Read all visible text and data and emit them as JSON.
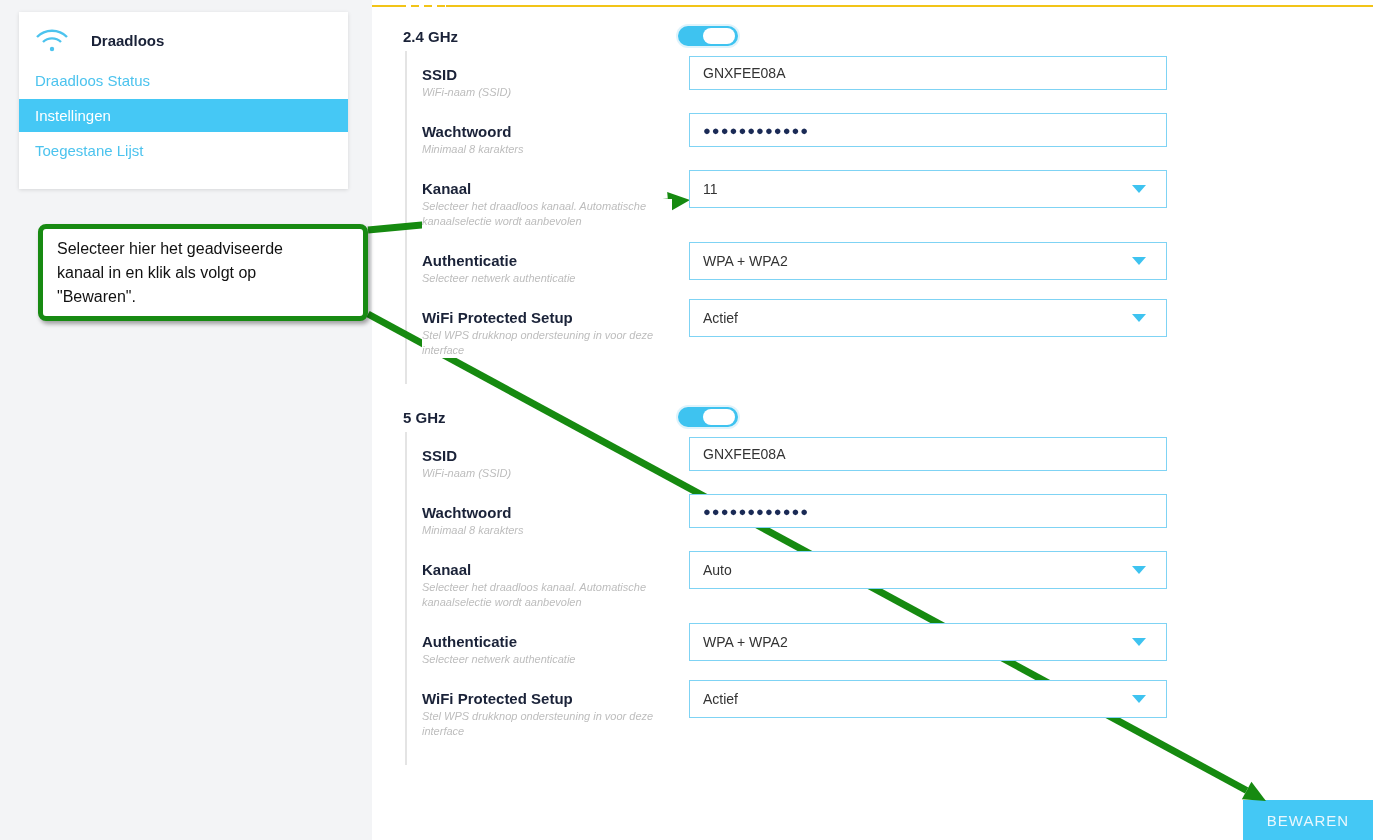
{
  "sidebar": {
    "title": "Draadloos",
    "items": [
      {
        "label": "Draadloos Status",
        "selected": false
      },
      {
        "label": "Instellingen",
        "selected": true
      },
      {
        "label": "Toegestane Lijst",
        "selected": false
      }
    ]
  },
  "bands": [
    {
      "name": "2.4 GHz",
      "enabled": true,
      "fields": [
        {
          "kind": "input",
          "label": "SSID",
          "hint": "WiFi-naam (SSID)",
          "value": "GNXFEE08A"
        },
        {
          "kind": "password",
          "label": "Wachtwoord",
          "hint": "Minimaal 8 karakters",
          "value": "●●●●●●●●●●●●"
        },
        {
          "kind": "select",
          "label": "Kanaal",
          "hint": "Selecteer het draadloos kanaal. Automatische kanaalselectie wordt aanbevolen",
          "value": "11"
        },
        {
          "kind": "select",
          "label": "Authenticatie",
          "hint": "Selecteer netwerk authenticatie",
          "value": "WPA + WPA2"
        },
        {
          "kind": "select",
          "label": "WiFi Protected Setup",
          "hint": "Stel WPS drukknop ondersteuning in voor deze interface",
          "value": "Actief"
        }
      ]
    },
    {
      "name": "5 GHz",
      "enabled": true,
      "fields": [
        {
          "kind": "input",
          "label": "SSID",
          "hint": "WiFi-naam (SSID)",
          "value": "GNXFEE08A"
        },
        {
          "kind": "password",
          "label": "Wachtwoord",
          "hint": "Minimaal 8 karakters",
          "value": "●●●●●●●●●●●●"
        },
        {
          "kind": "select",
          "label": "Kanaal",
          "hint": "Selecteer het draadloos kanaal. Automatische kanaalselectie wordt aanbevolen",
          "value": "Auto"
        },
        {
          "kind": "select",
          "label": "Authenticatie",
          "hint": "Selecteer netwerk authenticatie",
          "value": "WPA + WPA2"
        },
        {
          "kind": "select",
          "label": "WiFi Protected Setup",
          "hint": "Stel WPS drukknop ondersteuning in voor deze interface",
          "value": "Actief"
        }
      ]
    }
  ],
  "save_button": "BEWAREN",
  "callout": {
    "text": "Selecteer hier het geadviseerde kanaal in en klik als volgt op \"Bewaren\"."
  }
}
